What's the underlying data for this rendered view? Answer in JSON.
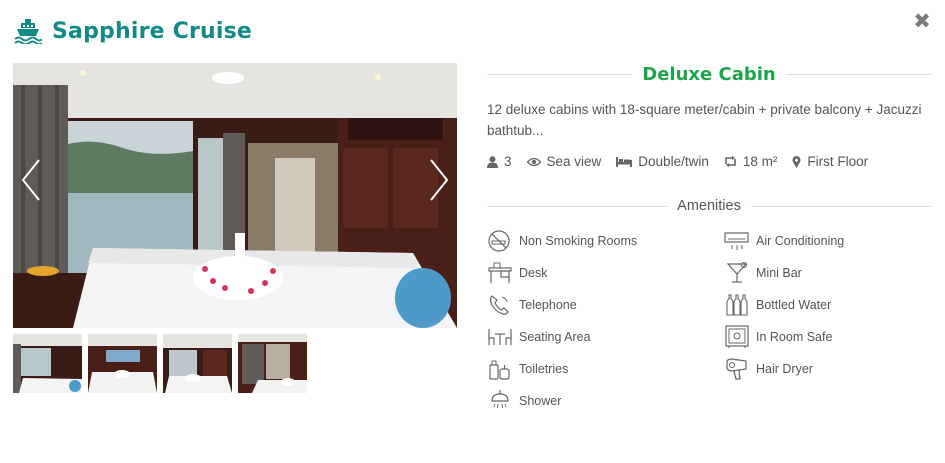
{
  "header": {
    "title": "Sapphire Cruise",
    "close_symbol": "✖"
  },
  "gallery": {
    "thumbnail_count": 4
  },
  "cabin": {
    "name": "Deluxe Cabin",
    "description": "12 deluxe cabins with 18-square meter/cabin + private balcony + Jacuzzi bathtub...",
    "specs": {
      "guests": "3",
      "view": "Sea view",
      "bed": "Double/twin",
      "area": "18 m²",
      "floor": "First Floor"
    }
  },
  "amenities": {
    "title": "Amenities",
    "items": [
      {
        "label": "Non Smoking Rooms",
        "icon": "no-smoking-icon"
      },
      {
        "label": "Air Conditioning",
        "icon": "air-conditioner-icon"
      },
      {
        "label": "Desk",
        "icon": "desk-icon"
      },
      {
        "label": "Mini Bar",
        "icon": "cocktail-icon"
      },
      {
        "label": "Telephone",
        "icon": "telephone-icon"
      },
      {
        "label": "Bottled Water",
        "icon": "bottles-icon"
      },
      {
        "label": "Seating Area",
        "icon": "seating-icon"
      },
      {
        "label": "In Room Safe",
        "icon": "safe-icon"
      },
      {
        "label": "Toiletries",
        "icon": "toiletries-icon"
      },
      {
        "label": "Hair Dryer",
        "icon": "hair-dryer-icon"
      },
      {
        "label": "Shower",
        "icon": "shower-icon"
      }
    ]
  },
  "colors": {
    "brand": "#148a87",
    "cabin_title": "#1fa34a"
  }
}
